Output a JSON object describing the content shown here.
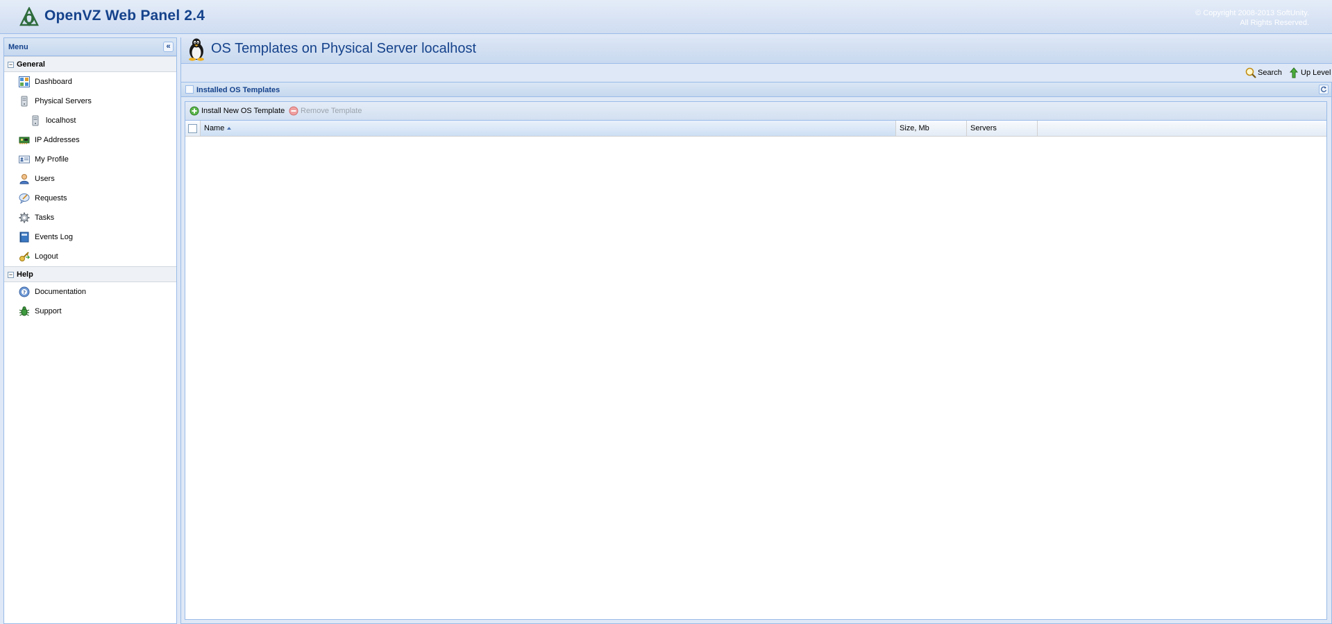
{
  "app": {
    "title": "OpenVZ Web Panel 2.4",
    "copyright_line1": "© Copyright 2008-2013 SoftUnity.",
    "copyright_line2": "All Rights Reserved."
  },
  "sidebar": {
    "title": "Menu",
    "collapse_glyph": "«",
    "groups": [
      {
        "label": "General",
        "toggle": "−",
        "items": [
          {
            "label": "Dashboard",
            "icon": "dashboard-icon"
          },
          {
            "label": "Physical Servers",
            "icon": "server-icon"
          },
          {
            "label": "localhost",
            "icon": "server-icon",
            "sub": true
          },
          {
            "label": "IP Addresses",
            "icon": "network-card-icon"
          },
          {
            "label": "My Profile",
            "icon": "profile-card-icon"
          },
          {
            "label": "Users",
            "icon": "user-icon"
          },
          {
            "label": "Requests",
            "icon": "request-icon"
          },
          {
            "label": "Tasks",
            "icon": "gear-icon"
          },
          {
            "label": "Events Log",
            "icon": "log-book-icon"
          },
          {
            "label": "Logout",
            "icon": "logout-key-icon"
          }
        ]
      },
      {
        "label": "Help",
        "toggle": "−",
        "items": [
          {
            "label": "Documentation",
            "icon": "help-icon"
          },
          {
            "label": "Support",
            "icon": "support-bug-icon"
          }
        ]
      }
    ]
  },
  "page": {
    "title": "OS Templates on Physical Server localhost",
    "actions": {
      "search": "Search",
      "up_level": "Up Level"
    }
  },
  "templates_panel": {
    "title": "Installed OS Templates",
    "toolbar": {
      "install": "Install New OS Template",
      "remove": "Remove Template"
    },
    "columns": {
      "name": "Name",
      "size": "Size, Mb",
      "servers": "Servers"
    },
    "rows": []
  },
  "colors": {
    "accent": "#15428b",
    "border": "#99bbe8",
    "panel_bg": "#dfe8f6"
  }
}
